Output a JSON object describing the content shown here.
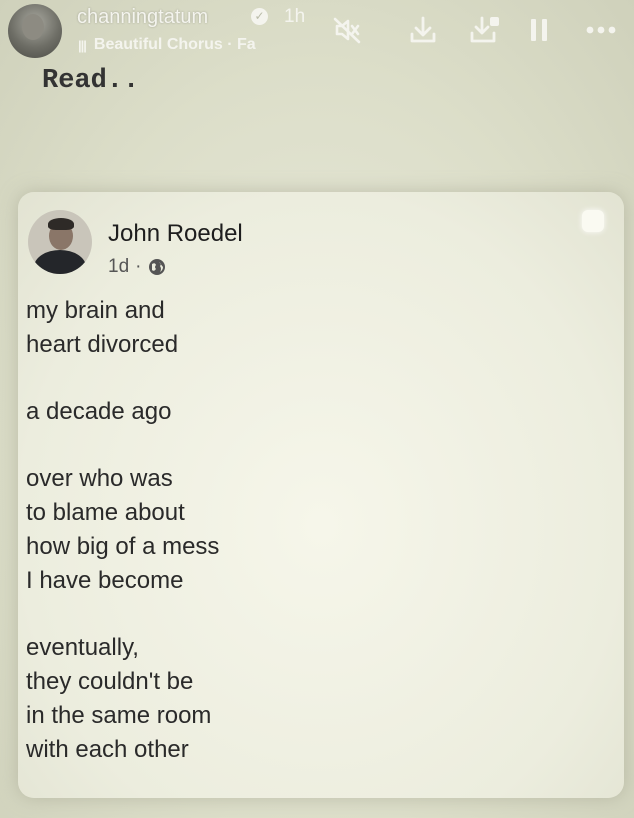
{
  "story_header": {
    "username": "channingtatum",
    "time": "1h",
    "music_label": "Beautiful Chorus · Fa"
  },
  "caption": "Read..",
  "post": {
    "author": "John Roedel",
    "age": "1d",
    "separator": "·",
    "stanzas": [
      [
        "my brain and",
        "heart divorced"
      ],
      [
        "a decade ago"
      ],
      [
        "over who was",
        "to blame about",
        "how big of a mess",
        "I have become"
      ],
      [
        "eventually,",
        "they couldn't be",
        "in the same room",
        "with each other"
      ]
    ]
  },
  "icons": {
    "verified": "verified-badge-icon",
    "music": "music-bars-icon",
    "mute": "mute-icon",
    "download": "download-icon",
    "save": "save-to-collection-icon",
    "pause": "pause-icon",
    "more": "more-options-icon",
    "globe": "globe-icon"
  },
  "colors": {
    "overlay_text": "#f4f4ee",
    "background": "#dcdec9",
    "card": "#f1f1e4",
    "body_text": "#2a2a2a"
  }
}
